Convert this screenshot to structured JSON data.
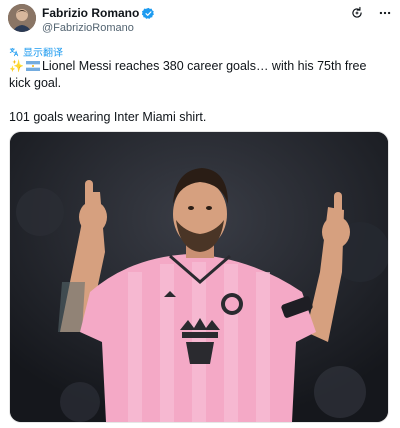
{
  "author": {
    "name": "Fabrizio Romano",
    "handle": "@FabrizioRomano",
    "verified": true,
    "verified_color": "#1d9bf0"
  },
  "header_icons": [
    "refresh-sparkle-icon",
    "more-icon"
  ],
  "translate": {
    "label": "显示翻译",
    "icon": "translate-icon",
    "color": "#1d9bf0"
  },
  "tweet": {
    "emoji_prefix": "✨",
    "flag": "argentina",
    "line1": "Lionel Messi reaches 380 career goals… with his 75th free kick goal.",
    "line2": "101 goals wearing Inter Miami shirt."
  },
  "media": {
    "alt": "Lionel Messi in pink Inter Miami shirt pointing both index fingers upward",
    "colors": {
      "shirt": "#f4a9c6",
      "stripe": "#f7bfd6",
      "background": "#1d1f25",
      "crest": "#2a2a2f"
    }
  }
}
